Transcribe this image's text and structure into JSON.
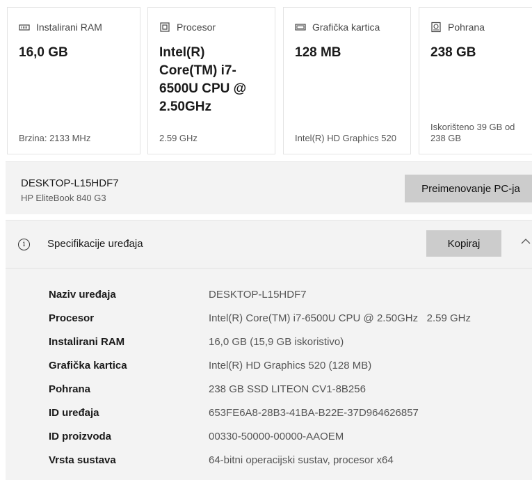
{
  "cards": [
    {
      "icon": "ram-icon",
      "title": "Instalirani RAM",
      "value": "16,0 GB",
      "footer": "Brzina: 2133 MHz"
    },
    {
      "icon": "processor-icon",
      "title": "Procesor",
      "value": "Intel(R) Core(TM) i7-6500U CPU @ 2.50GHz",
      "footer": "2.59 GHz"
    },
    {
      "icon": "graphics-card-icon",
      "title": "Grafička kartica",
      "value": "128 MB",
      "footer": "Intel(R) HD Graphics 520"
    },
    {
      "icon": "storage-icon",
      "title": "Pohrana",
      "value": "238 GB",
      "footer": "Iskorišteno 39 GB od 238 GB"
    }
  ],
  "pc": {
    "name": "DESKTOP-L15HDF7",
    "model": "HP EliteBook 840 G3",
    "rename_label": "Preimenovanje PC-ja"
  },
  "spec": {
    "title": "Specifikacije uređaja",
    "copy_label": "Kopiraj",
    "rows": [
      {
        "label": "Naziv uređaja",
        "value": "DESKTOP-L15HDF7"
      },
      {
        "label": "Procesor",
        "value": "Intel(R) Core(TM) i7-6500U CPU @ 2.50GHz   2.59 GHz"
      },
      {
        "label": "Instalirani RAM",
        "value": "16,0 GB (15,9 GB iskoristivo)"
      },
      {
        "label": "Grafička kartica",
        "value": "Intel(R) HD Graphics 520 (128 MB)"
      },
      {
        "label": "Pohrana",
        "value": "238 GB SSD LITEON CV1-8B256"
      },
      {
        "label": "ID uređaja",
        "value": "653FE6A8-28B3-41BA-B22E-37D964626857"
      },
      {
        "label": "ID proizvoda",
        "value": "00330-50000-00000-AAOEM"
      },
      {
        "label": "Vrsta sustava",
        "value": "64-bitni operacijski sustav, procesor x64"
      }
    ]
  }
}
